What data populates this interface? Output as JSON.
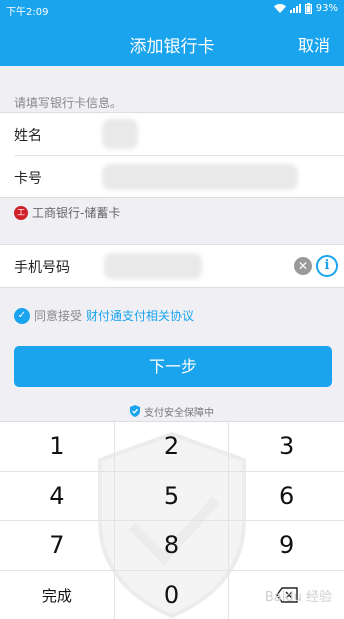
{
  "status_bar": {
    "time": "下午2:09",
    "battery": "93%"
  },
  "nav": {
    "title": "添加银行卡",
    "cancel": "取消"
  },
  "form": {
    "hint": "请填写银行卡信息。",
    "name_label": "姓名",
    "card_label": "卡号",
    "bank_text": "工商银行-储蓄卡",
    "bank_logo_glyph": "工",
    "phone_label": "手机号码"
  },
  "agreement": {
    "prefix": "同意接受",
    "link": "财付通支付相关协议"
  },
  "next_button": "下一步",
  "secure_text": "支付安全保障中",
  "keypad": {
    "keys": [
      "1",
      "2",
      "3",
      "4",
      "5",
      "6",
      "7",
      "8",
      "9",
      "完成",
      "0"
    ],
    "watermark": "Baidu 经验"
  },
  "colors": {
    "accent": "#1aa4ee",
    "bank_red": "#d0202a"
  }
}
